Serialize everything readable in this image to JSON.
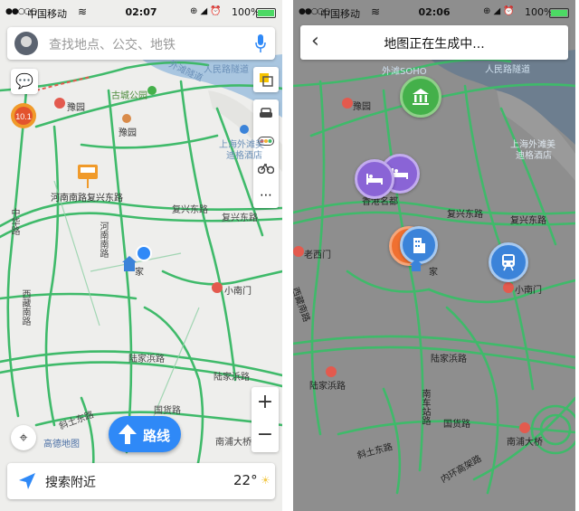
{
  "left": {
    "status": {
      "carrier": "中国移动",
      "time": "02:07",
      "battery": "100%"
    },
    "search": {
      "placeholder": "查找地点、公交、地铁"
    },
    "badge": {
      "value": "10.1"
    },
    "labels": {
      "road1": "外滩隧道",
      "road2": "人民路隧道",
      "place1": "豫园",
      "place2": "古城公园",
      "place3": "豫园",
      "place4": "上海外滩美",
      "place4b": "迪格酒店",
      "place5": "河南南路复兴东路",
      "road3": "复兴东路",
      "road4": "复兴东路",
      "road5": "河南南路",
      "road6": "中华路",
      "road7": "西藏南路",
      "home": "家",
      "place6": "小南门",
      "road8": "陆家浜路",
      "road9": "陆家浜路",
      "road10": "斜土东路",
      "road11": "南浦大桥",
      "road12": "国货路"
    },
    "brand": "高德地图",
    "route_label": "路线",
    "zoom": {
      "in": "+",
      "out": "−"
    },
    "bottom": {
      "text": "搜索附近",
      "temp": "22°"
    }
  },
  "right": {
    "status": {
      "carrier": "中国移动",
      "time": "02:06",
      "battery": "100%"
    },
    "title": "地图正在生成中...",
    "labels": {
      "road1": "外滩SOHO",
      "road2": "人民路隧道",
      "place1": "豫园",
      "place4": "上海外滩美",
      "place4b": "迪格酒店",
      "place5": "香港名都",
      "road3": "复兴东路",
      "road4": "复兴东路",
      "place6": "老西门",
      "road7": "西藏南路",
      "home": "家",
      "place7": "小南门",
      "road8": "陆家浜路",
      "road9": "陆家浜路",
      "road12": "国货路",
      "road10": "斜土东路",
      "road13": "南浦大桥",
      "road14": "内环高架路",
      "road15": "南车站路"
    }
  },
  "colors": {
    "road_green": "#3fba6a",
    "river": "#a9c6e0",
    "accent": "#2f89f7",
    "poi_green": "#44b04a",
    "poi_purple": "#8a64d6",
    "poi_blue": "#3b83d9",
    "poi_orange": "#f07030"
  }
}
